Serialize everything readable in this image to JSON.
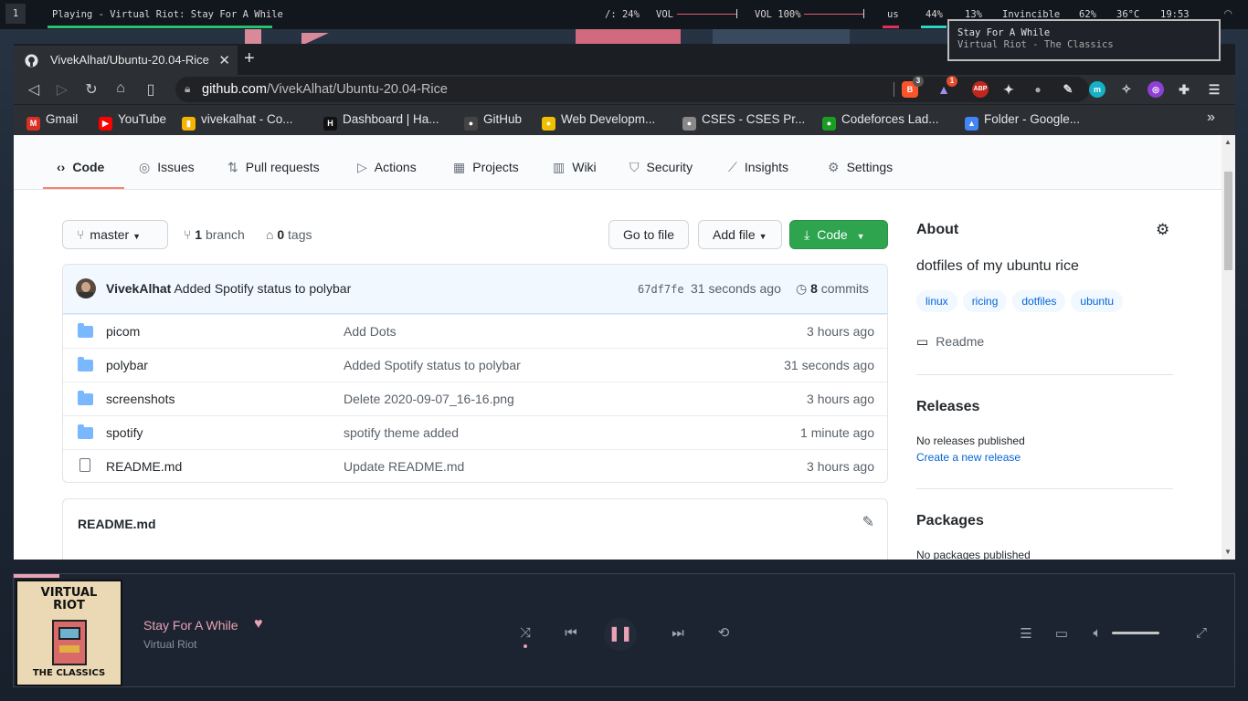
{
  "polybar": {
    "workspace": "1",
    "now_playing": "Playing - Virtual Riot: Stay For A While",
    "disk": "/: 24%",
    "vol_label": "VOL",
    "vol2_label": "VOL 100%",
    "keyboard": "us",
    "cpu": "44%",
    "mem": "13%",
    "wifi_name": "Invincible",
    "battery": "62%",
    "temp": "36°C",
    "time": "19:53"
  },
  "notification": {
    "title": "Stay For A While",
    "body": "Virtual Riot - The Classics"
  },
  "browser": {
    "tab_title": "VivekAlhat/Ubuntu-20.04-Rice",
    "url_host": "github.com",
    "url_path": "/VivekAlhat/Ubuntu-20.04-Rice",
    "ext_badge_brave": "3",
    "ext_badge_rewards": "1",
    "ext_abp": "ABP",
    "bookmarks": [
      {
        "label": "Gmail",
        "color": "#d93025",
        "icon": "M"
      },
      {
        "label": "YouTube",
        "color": "#ff0000",
        "icon": "▶"
      },
      {
        "label": "vivekalhat - Co...",
        "color": "#f4b400",
        "icon": "▮"
      },
      {
        "label": "Dashboard | Ha...",
        "color": "#111111",
        "icon": "H"
      },
      {
        "label": "GitHub",
        "color": "#444444",
        "icon": "●"
      },
      {
        "label": "Web Developm...",
        "color": "#f0c000",
        "icon": "●"
      },
      {
        "label": "CSES - CSES Pr...",
        "color": "#888888",
        "icon": "●"
      },
      {
        "label": "Codeforces Lad...",
        "color": "#1a9e22",
        "icon": "●"
      },
      {
        "label": "Folder - Google...",
        "color": "#4285f4",
        "icon": "▲"
      }
    ],
    "more_bookmarks": "»"
  },
  "repo": {
    "tabs": [
      {
        "label": "Code",
        "icon": "code-icon"
      },
      {
        "label": "Issues",
        "icon": "issue-icon"
      },
      {
        "label": "Pull requests",
        "icon": "pull-request-icon"
      },
      {
        "label": "Actions",
        "icon": "play-icon"
      },
      {
        "label": "Projects",
        "icon": "project-icon"
      },
      {
        "label": "Wiki",
        "icon": "book-icon"
      },
      {
        "label": "Security",
        "icon": "shield-icon"
      },
      {
        "label": "Insights",
        "icon": "graph-icon"
      },
      {
        "label": "Settings",
        "icon": "gear-icon"
      }
    ],
    "branch": "master",
    "branch_count": "1",
    "branch_word": "branch",
    "tag_count": "0",
    "tag_word": "tags",
    "go_to_file": "Go to file",
    "add_file": "Add file",
    "code_button": "Code",
    "commit": {
      "author": "VivekAlhat",
      "message": "Added Spotify status to polybar",
      "sha": "67df7fe",
      "time": "31 seconds ago",
      "count": "8",
      "count_word": "commits"
    },
    "files": [
      {
        "name": "picom",
        "type": "folder",
        "message": "Add Dots",
        "age": "3 hours ago"
      },
      {
        "name": "polybar",
        "type": "folder",
        "message": "Added Spotify status to polybar",
        "age": "31 seconds ago"
      },
      {
        "name": "screenshots",
        "type": "folder",
        "message": "Delete 2020-09-07_16-16.png",
        "age": "3 hours ago"
      },
      {
        "name": "spotify",
        "type": "folder",
        "message": "spotify theme added",
        "age": "1 minute ago"
      },
      {
        "name": "README.md",
        "type": "file",
        "message": "Update README.md",
        "age": "3 hours ago"
      }
    ],
    "readme_title": "README.md",
    "about": {
      "heading": "About",
      "description": "dotfiles of my ubuntu rice",
      "topics": [
        "linux",
        "ricing",
        "dotfiles",
        "ubuntu"
      ],
      "readme_link": "Readme",
      "releases_heading": "Releases",
      "releases_text": "No releases published",
      "releases_link": "Create a new release",
      "packages_heading": "Packages",
      "packages_text": "No packages published"
    }
  },
  "spotify": {
    "title": "Stay For A While",
    "artist": "Virtual Riot",
    "album_art_text_top": "VIRTUAL RIOT",
    "album_art_text_bottom": "THE CLASSICS",
    "accent": "#e9a3b4"
  }
}
